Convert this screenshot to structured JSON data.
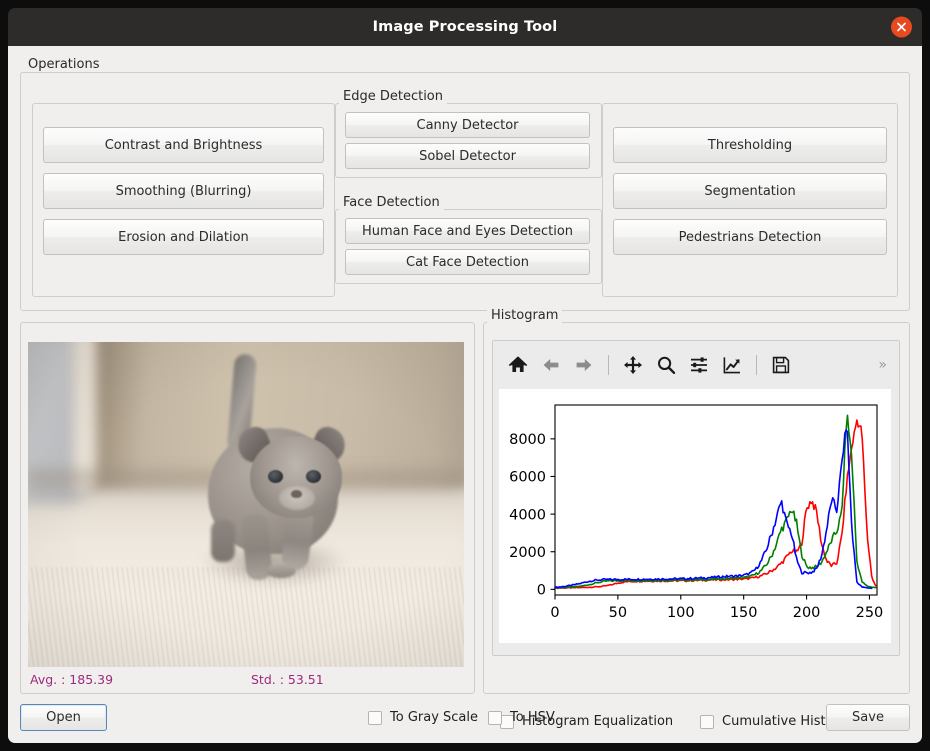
{
  "window": {
    "title": "Image Processing Tool",
    "close_icon": "close-icon",
    "accent_close": "#e8491f",
    "titlebar_bg": "#2e2c2a",
    "body_bg": "#f0efee"
  },
  "operations": {
    "title": "Operations",
    "basic_group": {
      "buttons": [
        {
          "label": "Contrast and Brightness"
        },
        {
          "label": "Smoothing (Blurring)"
        },
        {
          "label": "Erosion and Dilation"
        }
      ]
    },
    "edge_group": {
      "title": "Edge Detection",
      "buttons": [
        {
          "label": "Canny Detector"
        },
        {
          "label": "Sobel Detector"
        }
      ]
    },
    "face_group": {
      "title": "Face Detection",
      "buttons": [
        {
          "label": "Human Face and Eyes Detection"
        },
        {
          "label": "Cat Face Detection"
        }
      ]
    },
    "misc_group": {
      "buttons": [
        {
          "label": "Thresholding"
        },
        {
          "label": "Segmentation"
        },
        {
          "label": "Pedestrians Detection"
        }
      ]
    }
  },
  "preview": {
    "image_alt": "grey kitten walking on beige carpet",
    "avg_label": "Avg. : 185.39",
    "std_label": "Std. : 53.51",
    "stat_color": "#9c2a7e"
  },
  "histogram_panel": {
    "title": "Histogram",
    "toolbar": [
      {
        "name": "home-icon",
        "tooltip": "Home"
      },
      {
        "name": "back-arrow-icon",
        "tooltip": "Back"
      },
      {
        "name": "forward-arrow-icon",
        "tooltip": "Forward"
      },
      {
        "name": "pan-move-icon",
        "tooltip": "Pan"
      },
      {
        "name": "zoom-magnifier-icon",
        "tooltip": "Zoom to rectangle"
      },
      {
        "name": "subplot-sliders-icon",
        "tooltip": "Configure subplots"
      },
      {
        "name": "edit-curve-icon",
        "tooltip": "Edit axis, curve and image parameters"
      },
      {
        "name": "save-floppy-icon",
        "tooltip": "Save the figure"
      }
    ],
    "overflow_label": "»",
    "checkboxes": [
      {
        "label": "Histogram Equalization",
        "checked": false
      },
      {
        "label": "Cumulative Histogram",
        "checked": false
      }
    ]
  },
  "footer": {
    "open_label": "Open",
    "save_label": "Save",
    "checkboxes": [
      {
        "label": "To Gray Scale",
        "checked": false
      },
      {
        "label": "To HSV",
        "checked": false
      }
    ]
  },
  "chart_data": {
    "type": "line",
    "title": "",
    "xlabel": "",
    "ylabel": "",
    "xlim": [
      0,
      256
    ],
    "ylim": [
      -300,
      9800
    ],
    "xticks": [
      0,
      50,
      100,
      150,
      200,
      250
    ],
    "yticks": [
      0,
      2000,
      4000,
      6000,
      8000
    ],
    "grid": false,
    "legend": "none",
    "x": [
      0,
      4,
      8,
      12,
      16,
      20,
      24,
      28,
      32,
      36,
      40,
      44,
      48,
      52,
      56,
      60,
      64,
      68,
      72,
      76,
      80,
      84,
      88,
      92,
      96,
      100,
      104,
      108,
      112,
      116,
      120,
      124,
      128,
      132,
      136,
      140,
      144,
      148,
      152,
      156,
      160,
      164,
      168,
      172,
      176,
      180,
      184,
      188,
      192,
      196,
      200,
      204,
      208,
      212,
      216,
      220,
      224,
      228,
      232,
      236,
      240,
      244,
      248,
      252,
      255
    ],
    "series": [
      {
        "name": "Red",
        "color": "#ff0000",
        "values": [
          60,
          70,
          75,
          80,
          85,
          95,
          105,
          115,
          130,
          150,
          180,
          230,
          300,
          360,
          400,
          420,
          430,
          435,
          440,
          440,
          445,
          445,
          450,
          450,
          455,
          455,
          460,
          465,
          470,
          480,
          490,
          500,
          505,
          510,
          515,
          520,
          530,
          545,
          560,
          590,
          650,
          720,
          830,
          980,
          1150,
          1400,
          1700,
          2050,
          1950,
          2400,
          4300,
          4750,
          4100,
          2400,
          1500,
          1250,
          1400,
          2800,
          5700,
          7600,
          9000,
          8400,
          3000,
          600,
          180
        ]
      },
      {
        "name": "Green",
        "color": "#008000",
        "values": [
          80,
          90,
          100,
          115,
          135,
          165,
          210,
          265,
          330,
          390,
          430,
          450,
          455,
          460,
          465,
          468,
          470,
          470,
          472,
          475,
          478,
          480,
          482,
          485,
          488,
          490,
          495,
          500,
          505,
          510,
          520,
          530,
          545,
          560,
          575,
          590,
          600,
          610,
          640,
          700,
          820,
          1000,
          1300,
          1750,
          2400,
          3200,
          3600,
          4300,
          3500,
          1900,
          1200,
          1150,
          1200,
          1450,
          2000,
          2600,
          3100,
          4000,
          9400,
          7000,
          1500,
          400,
          180,
          120,
          90
        ]
      },
      {
        "name": "Blue",
        "color": "#0000ff",
        "values": [
          110,
          130,
          160,
          200,
          250,
          310,
          380,
          440,
          480,
          505,
          520,
          525,
          528,
          530,
          532,
          535,
          538,
          540,
          542,
          545,
          548,
          550,
          553,
          556,
          560,
          565,
          570,
          580,
          590,
          600,
          615,
          630,
          650,
          670,
          690,
          700,
          710,
          730,
          780,
          880,
          1100,
          1500,
          2100,
          2900,
          3800,
          4700,
          3500,
          3000,
          1600,
          900,
          880,
          900,
          1100,
          1800,
          3200,
          4800,
          4200,
          6700,
          8950,
          3200,
          400,
          120,
          80,
          60
        ]
      }
    ]
  }
}
